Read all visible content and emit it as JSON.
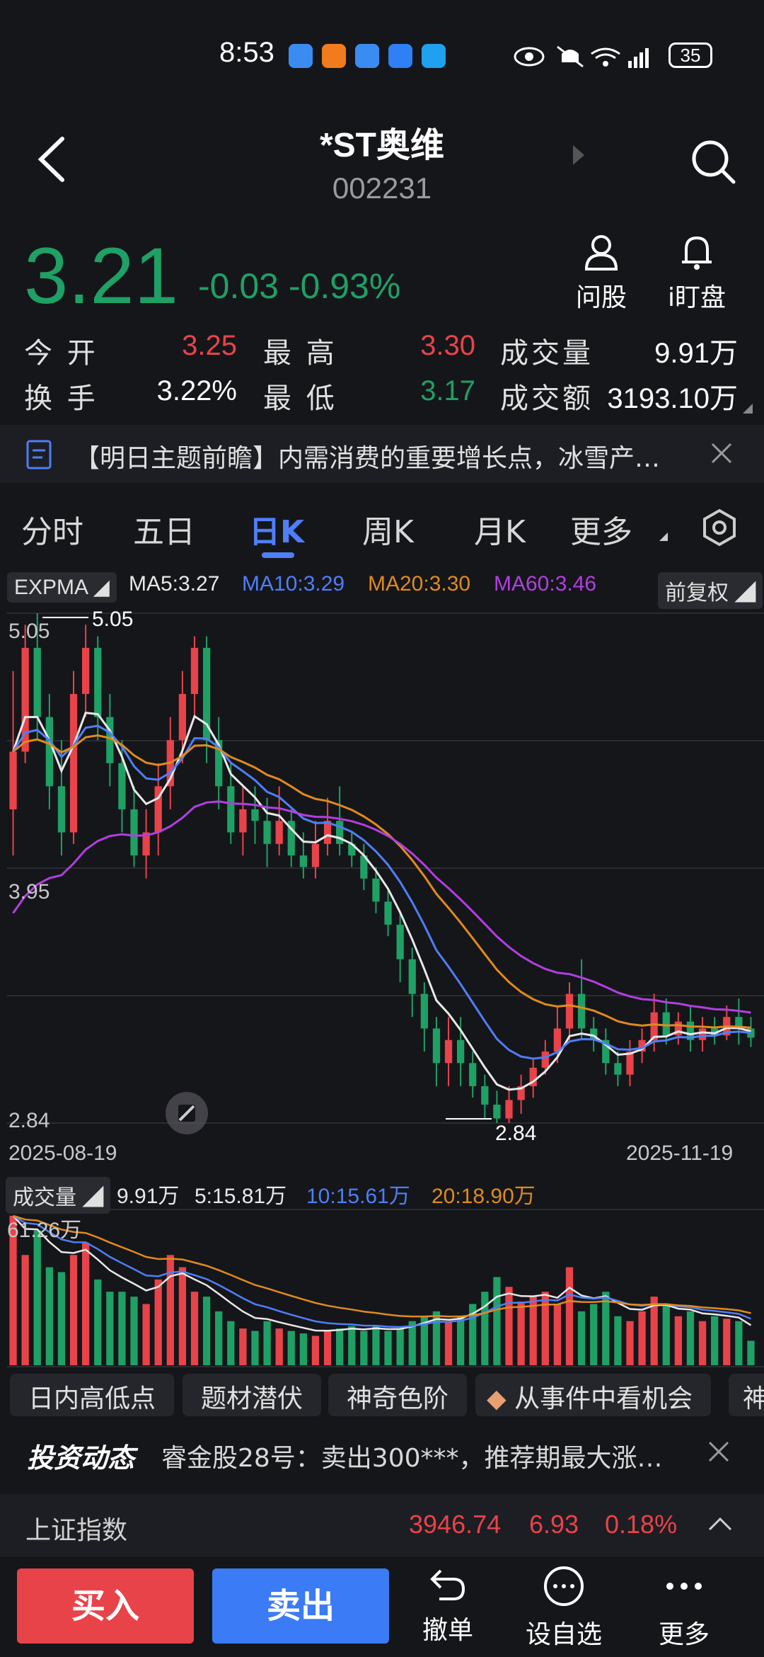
{
  "status": {
    "time": "8:53",
    "battery": "35"
  },
  "header": {
    "title": "*ST奥维",
    "code": "002231"
  },
  "quote": {
    "price": "3.21",
    "change": "-0.03",
    "change_pct": "-0.93%",
    "ask_label": "问股",
    "alert_label": "i盯盘",
    "stats": [
      {
        "label": "今 开",
        "value": "3.25"
      },
      {
        "label": "最 高",
        "value": "3.30"
      },
      {
        "label": "成交量",
        "value": "9.91万"
      },
      {
        "label": "换 手",
        "value": "3.22%"
      },
      {
        "label": "最 低",
        "value": "3.17"
      },
      {
        "label": "成交额",
        "value": "3193.10万"
      }
    ]
  },
  "news": {
    "text": "【明日主题前瞻】内需消费的重要增长点，冰雪产…"
  },
  "tabs": [
    "分时",
    "五日",
    "日K",
    "周K",
    "月K",
    "更多"
  ],
  "indicators": {
    "main": "EXPMA",
    "ma5": "MA5:3.27",
    "ma10": "MA10:3.29",
    "ma20": "MA20:3.30",
    "ma60": "MA60:3.46",
    "adjust": "前复权",
    "y_top": "5.05",
    "y_mid": "3.95",
    "y_bot": "2.84",
    "max_mark": "5.05",
    "min_mark": "2.84",
    "date_start": "2025-08-19",
    "date_end": "2025-11-19"
  },
  "volume": {
    "label": "成交量",
    "vol": "9.91万",
    "v5": "5:15.81万",
    "v10": "10:15.61万",
    "v20": "20:18.90万",
    "max": "61.26万"
  },
  "quick_buttons": [
    "日内高低点",
    "题材潜伏",
    "神奇色阶",
    "从事件中看机会",
    "神"
  ],
  "feed": {
    "brand": "投资动态",
    "text": "睿金股28号：卖出300***，推荐期最大涨…"
  },
  "ticker": {
    "name": "上证指数",
    "value": "3946.74",
    "change": "6.93",
    "pct": "0.18%"
  },
  "bottom": {
    "buy": "买入",
    "sell": "卖出",
    "cancel": "撤单",
    "watch": "设自选",
    "more": "更多"
  },
  "colors": {
    "up": "#e9434a",
    "down": "#1fa065",
    "ma5": "#e8e8e8",
    "ma10": "#4f7ef8",
    "ma20": "#e08a1e",
    "ma60": "#b13fe0"
  },
  "chart_data": {
    "type": "candlestick",
    "ylim": [
      2.84,
      5.05
    ],
    "candles": [
      [
        4.2,
        4.45,
        4.0,
        4.8
      ],
      [
        4.45,
        4.9,
        4.4,
        5.0
      ],
      [
        4.9,
        4.6,
        4.5,
        5.05
      ],
      [
        4.6,
        4.3,
        4.2,
        4.7
      ],
      [
        4.3,
        4.1,
        4.0,
        4.5
      ],
      [
        4.1,
        4.7,
        4.05,
        4.8
      ],
      [
        4.7,
        4.9,
        4.6,
        5.0
      ],
      [
        4.9,
        4.6,
        4.5,
        4.95
      ],
      [
        4.6,
        4.4,
        4.3,
        4.7
      ],
      [
        4.4,
        4.2,
        4.1,
        4.5
      ],
      [
        4.2,
        4.0,
        3.95,
        4.3
      ],
      [
        4.0,
        4.1,
        3.9,
        4.2
      ],
      [
        4.1,
        4.3,
        4.0,
        4.4
      ],
      [
        4.3,
        4.5,
        4.2,
        4.6
      ],
      [
        4.5,
        4.7,
        4.4,
        4.8
      ],
      [
        4.7,
        4.9,
        4.6,
        4.95
      ],
      [
        4.9,
        4.5,
        4.4,
        4.95
      ],
      [
        4.5,
        4.3,
        4.2,
        4.6
      ],
      [
        4.3,
        4.1,
        4.05,
        4.4
      ],
      [
        4.1,
        4.2,
        4.0,
        4.3
      ],
      [
        4.2,
        4.15,
        4.05,
        4.3
      ],
      [
        4.15,
        4.05,
        3.95,
        4.25
      ],
      [
        4.05,
        4.15,
        4.0,
        4.3
      ],
      [
        4.15,
        4.0,
        3.95,
        4.2
      ],
      [
        4.0,
        3.95,
        3.9,
        4.1
      ],
      [
        3.95,
        4.05,
        3.9,
        4.15
      ],
      [
        4.05,
        4.15,
        4.0,
        4.25
      ],
      [
        4.15,
        4.05,
        4.0,
        4.3
      ],
      [
        4.05,
        4.0,
        3.95,
        4.1
      ],
      [
        4.0,
        3.9,
        3.85,
        4.05
      ],
      [
        3.9,
        3.8,
        3.75,
        3.95
      ],
      [
        3.8,
        3.7,
        3.65,
        3.85
      ],
      [
        3.7,
        3.55,
        3.45,
        3.75
      ],
      [
        3.55,
        3.4,
        3.3,
        3.6
      ],
      [
        3.4,
        3.25,
        3.15,
        3.45
      ],
      [
        3.25,
        3.1,
        3.0,
        3.3
      ],
      [
        3.1,
        3.2,
        3.0,
        3.3
      ],
      [
        3.2,
        3.1,
        3.0,
        3.3
      ],
      [
        3.1,
        3.0,
        2.95,
        3.15
      ],
      [
        3.0,
        2.92,
        2.86,
        3.05
      ],
      [
        2.92,
        2.86,
        2.84,
        2.98
      ],
      [
        2.86,
        2.94,
        2.84,
        3.0
      ],
      [
        2.94,
        3.0,
        2.88,
        3.05
      ],
      [
        3.0,
        3.08,
        2.95,
        3.12
      ],
      [
        3.08,
        3.15,
        3.05,
        3.2
      ],
      [
        3.15,
        3.25,
        3.1,
        3.35
      ],
      [
        3.25,
        3.4,
        3.2,
        3.45
      ],
      [
        3.4,
        3.25,
        3.2,
        3.55
      ],
      [
        3.25,
        3.2,
        3.15,
        3.3
      ],
      [
        3.2,
        3.1,
        3.05,
        3.25
      ],
      [
        3.1,
        3.05,
        3.0,
        3.15
      ],
      [
        3.05,
        3.15,
        3.0,
        3.2
      ],
      [
        3.15,
        3.2,
        3.1,
        3.25
      ],
      [
        3.2,
        3.32,
        3.15,
        3.4
      ],
      [
        3.32,
        3.22,
        3.18,
        3.38
      ],
      [
        3.22,
        3.28,
        3.18,
        3.32
      ],
      [
        3.28,
        3.2,
        3.15,
        3.35
      ],
      [
        3.2,
        3.25,
        3.15,
        3.3
      ],
      [
        3.25,
        3.22,
        3.18,
        3.3
      ],
      [
        3.22,
        3.3,
        3.2,
        3.35
      ],
      [
        3.3,
        3.25,
        3.18,
        3.38
      ],
      [
        3.25,
        3.21,
        3.17,
        3.3
      ]
    ],
    "volumes": [
      61,
      45,
      55,
      40,
      38,
      45,
      50,
      35,
      30,
      30,
      28,
      25,
      35,
      45,
      40,
      30,
      28,
      22,
      18,
      15,
      14,
      18,
      15,
      14,
      13,
      12,
      14,
      15,
      16,
      14,
      16,
      14,
      15,
      18,
      20,
      22,
      18,
      20,
      25,
      30,
      36,
      32,
      26,
      28,
      30,
      25,
      40,
      22,
      25,
      30,
      20,
      18,
      22,
      28,
      25,
      20,
      22,
      18,
      20,
      19,
      18,
      10
    ]
  }
}
